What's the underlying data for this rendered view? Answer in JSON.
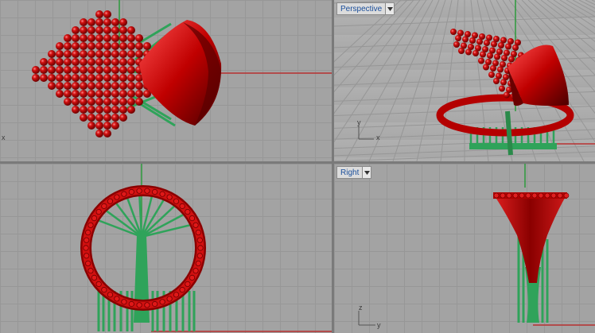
{
  "viewports": {
    "top": {
      "axis_x": "x"
    },
    "perspective": {
      "label": "Perspective",
      "axis_y": "y",
      "axis_x": "x"
    },
    "front": {},
    "right": {
      "label": "Right",
      "axis_z": "z",
      "axis_y": "y"
    }
  },
  "colors": {
    "model": "#c80000",
    "supports": "#2fa35a",
    "x_axis": "#b83030",
    "y_axis": "#2c9a3c"
  },
  "icons": {
    "dropdown": "chevron-down-icon"
  }
}
